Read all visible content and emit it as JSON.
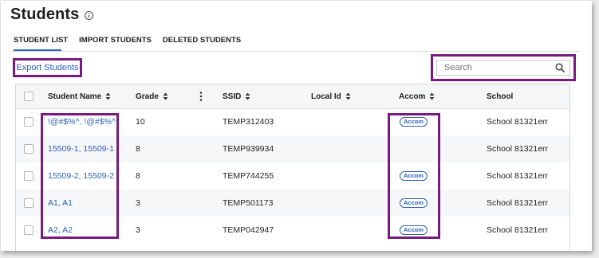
{
  "header": {
    "title": "Students",
    "info_icon": "info-circle-icon"
  },
  "tabs": [
    {
      "label": "STUDENT LIST",
      "active": true
    },
    {
      "label": "IMPORT STUDENTS",
      "active": false
    },
    {
      "label": "DELETED STUDENTS",
      "active": false
    }
  ],
  "toolbar": {
    "export_label": "Export Students"
  },
  "search": {
    "placeholder": "Search",
    "value": ""
  },
  "table": {
    "columns": [
      "Student Name",
      "Grade",
      "SSID",
      "Local Id",
      "Accom",
      "School"
    ],
    "rows": [
      {
        "name": "!@#$%^, !@#$%^",
        "grade": "10",
        "ssid": "TEMP312403",
        "local_id": "",
        "accom": "Accom",
        "school": "School 81321err"
      },
      {
        "name": "15509-1, 15509-1",
        "grade": "8",
        "ssid": "TEMP939934",
        "local_id": "",
        "accom": "",
        "school": "School 81321err"
      },
      {
        "name": "15509-2, 15509-2",
        "grade": "8",
        "ssid": "TEMP744255",
        "local_id": "",
        "accom": "Accom",
        "school": "School 81321err"
      },
      {
        "name": "A1, A1",
        "grade": "3",
        "ssid": "TEMP501173",
        "local_id": "",
        "accom": "Accom",
        "school": "School 81321err"
      },
      {
        "name": "A2, A2",
        "grade": "3",
        "ssid": "TEMP042947",
        "local_id": "",
        "accom": "Accom",
        "school": "School 81321err"
      }
    ]
  },
  "colors": {
    "accent": "#2b63b5",
    "highlight": "#7b1a7e"
  }
}
